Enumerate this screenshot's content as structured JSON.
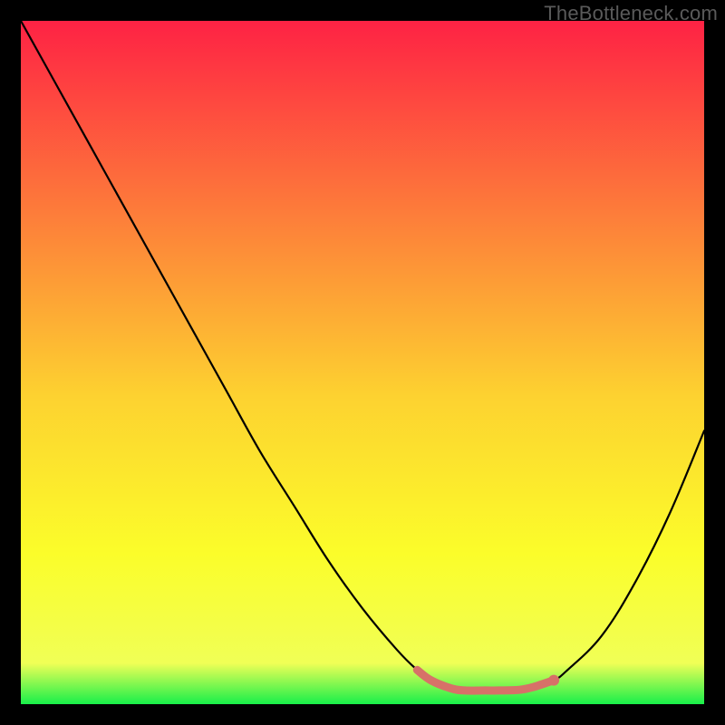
{
  "watermark": "TheBottleneck.com",
  "colors": {
    "gradient_top": "#fe2244",
    "gradient_q1": "#fd7c3a",
    "gradient_mid": "#fdd230",
    "gradient_q3": "#fbfd2a",
    "gradient_low": "#f0ff56",
    "gradient_bottom": "#18ef4a",
    "curve": "#000000",
    "marker": "#d77168",
    "frame": "#000000"
  },
  "chart_data": {
    "type": "line",
    "title": "",
    "xlabel": "",
    "ylabel": "",
    "xlim": [
      0,
      100
    ],
    "ylim": [
      0,
      100
    ],
    "grid": false,
    "legend": false,
    "series": [
      {
        "name": "bottleneck-curve",
        "x": [
          0,
          5,
          10,
          15,
          20,
          25,
          30,
          35,
          40,
          45,
          50,
          55,
          58,
          60,
          63,
          65,
          68,
          70,
          73,
          75,
          78,
          80,
          85,
          90,
          95,
          100
        ],
        "y": [
          100,
          91,
          82,
          73,
          64,
          55,
          46,
          37,
          29,
          21,
          14,
          8,
          5,
          3.5,
          2.3,
          2.0,
          2.0,
          2.0,
          2.1,
          2.5,
          3.5,
          5,
          10,
          18,
          28,
          40
        ]
      }
    ],
    "marker_segment": {
      "comment": "highlighted (pink) flat-bottom region of the curve",
      "x": [
        58,
        60,
        63,
        65,
        68,
        70,
        73,
        75,
        78
      ],
      "y": [
        5.0,
        3.5,
        2.3,
        2.0,
        2.0,
        2.0,
        2.1,
        2.5,
        3.5
      ]
    },
    "marker_point": {
      "x": 78,
      "y": 3.5
    }
  }
}
